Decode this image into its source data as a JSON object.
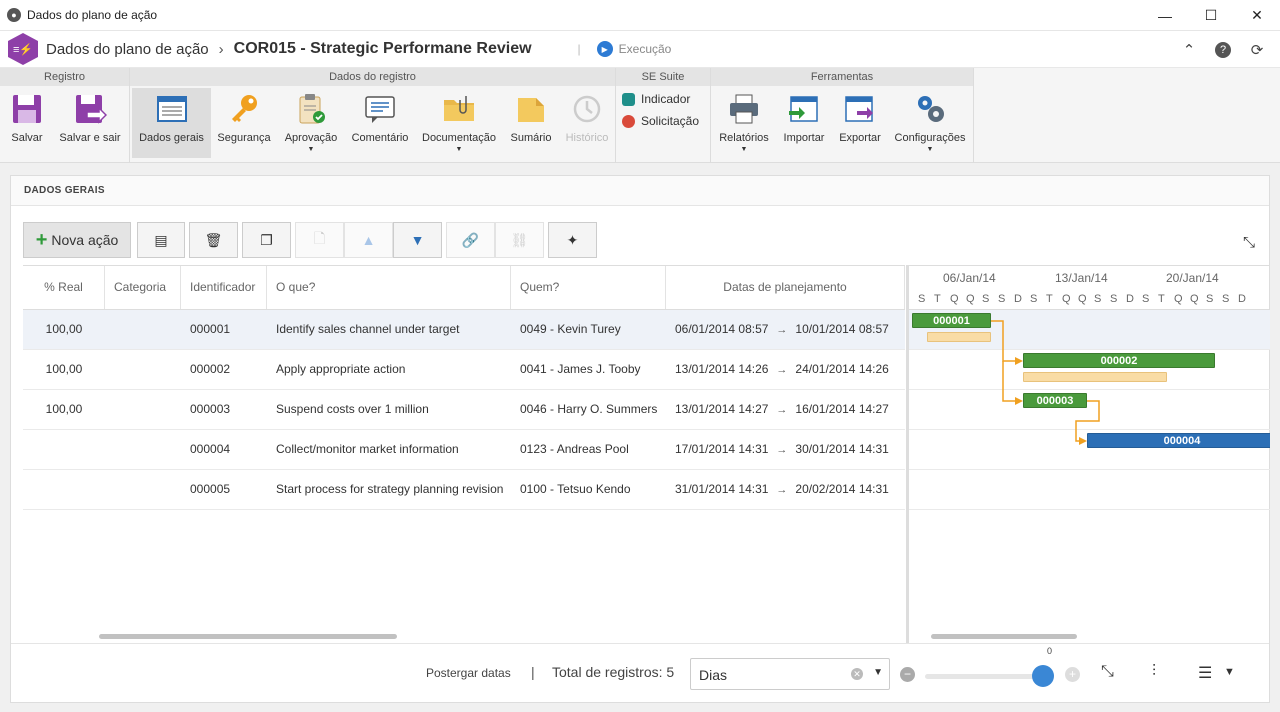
{
  "window": {
    "title": "Dados do plano de ação"
  },
  "header": {
    "section": "Dados do plano de ação",
    "record": "COR015 - Strategic Performane Review",
    "separator": "|",
    "status": "Execução"
  },
  "ribbon": {
    "groups": {
      "registro": "Registro",
      "dados": "Dados do registro",
      "suite": "SE Suite",
      "ferramentas": "Ferramentas"
    },
    "buttons": {
      "salvar": "Salvar",
      "salvar_sair": "Salvar e sair",
      "dados_gerais": "Dados gerais",
      "seguranca": "Segurança",
      "aprovacao": "Aprovação",
      "comentario": "Comentário",
      "documentacao": "Documentação",
      "sumario": "Sumário",
      "historico": "Histórico",
      "indicador": "Indicador",
      "solicitacao": "Solicitação",
      "relatorios": "Relatórios",
      "importar": "Importar",
      "exportar": "Exportar",
      "configuracoes": "Configurações"
    }
  },
  "panel": {
    "title": "DADOS GERAIS",
    "new_action": "Nova ação"
  },
  "grid": {
    "columns": {
      "real": "% Real",
      "categoria": "Categoria",
      "id": "Identificador",
      "what": "O que?",
      "who": "Quem?",
      "dates": "Datas de planejamento"
    },
    "rows": [
      {
        "real": "100,00",
        "categoria": "",
        "id": "000001",
        "what": "Identify sales channel under target",
        "who": "0049 - Kevin Turey",
        "start": "06/01/2014 08:57",
        "end": "10/01/2014 08:57"
      },
      {
        "real": "100,00",
        "categoria": "",
        "id": "000002",
        "what": "Apply appropriate action",
        "who": "0041 - James J. Tooby",
        "start": "13/01/2014 14:26",
        "end": "24/01/2014 14:26"
      },
      {
        "real": "100,00",
        "categoria": "",
        "id": "000003",
        "what": "Suspend costs over 1 million",
        "who": "0046 - Harry O. Summers",
        "start": "13/01/2014 14:27",
        "end": "16/01/2014 14:27"
      },
      {
        "real": "",
        "categoria": "",
        "id": "000004",
        "what": "Collect/monitor market information",
        "who": "0123 - Andreas Pool",
        "start": "17/01/2014 14:31",
        "end": "30/01/2014 14:31"
      },
      {
        "real": "",
        "categoria": "",
        "id": "000005",
        "what": "Start process for strategy planning revision",
        "who": "0100 - Tetsuo Kendo",
        "start": "31/01/2014 14:31",
        "end": "20/02/2014 14:31"
      }
    ]
  },
  "gantt": {
    "weeks": [
      "06/Jan/14",
      "13/Jan/14",
      "20/Jan/14"
    ],
    "days": [
      "S",
      "T",
      "Q",
      "Q",
      "S",
      "S",
      "D",
      "S",
      "T",
      "Q",
      "Q",
      "S",
      "S",
      "D",
      "S",
      "T",
      "Q",
      "Q",
      "S",
      "S",
      "D"
    ],
    "bars": [
      "000001",
      "000002",
      "000003",
      "000004"
    ],
    "colors": {
      "done": "#4a9a3c",
      "in_progress": "#2c6fb6",
      "planned": "#f9dca5",
      "link": "#f0a020"
    }
  },
  "footer": {
    "postpone": "Postergar datas",
    "separator": "|",
    "total": "Total de registros: 5",
    "scale": "Dias",
    "zoom_value": "0"
  }
}
